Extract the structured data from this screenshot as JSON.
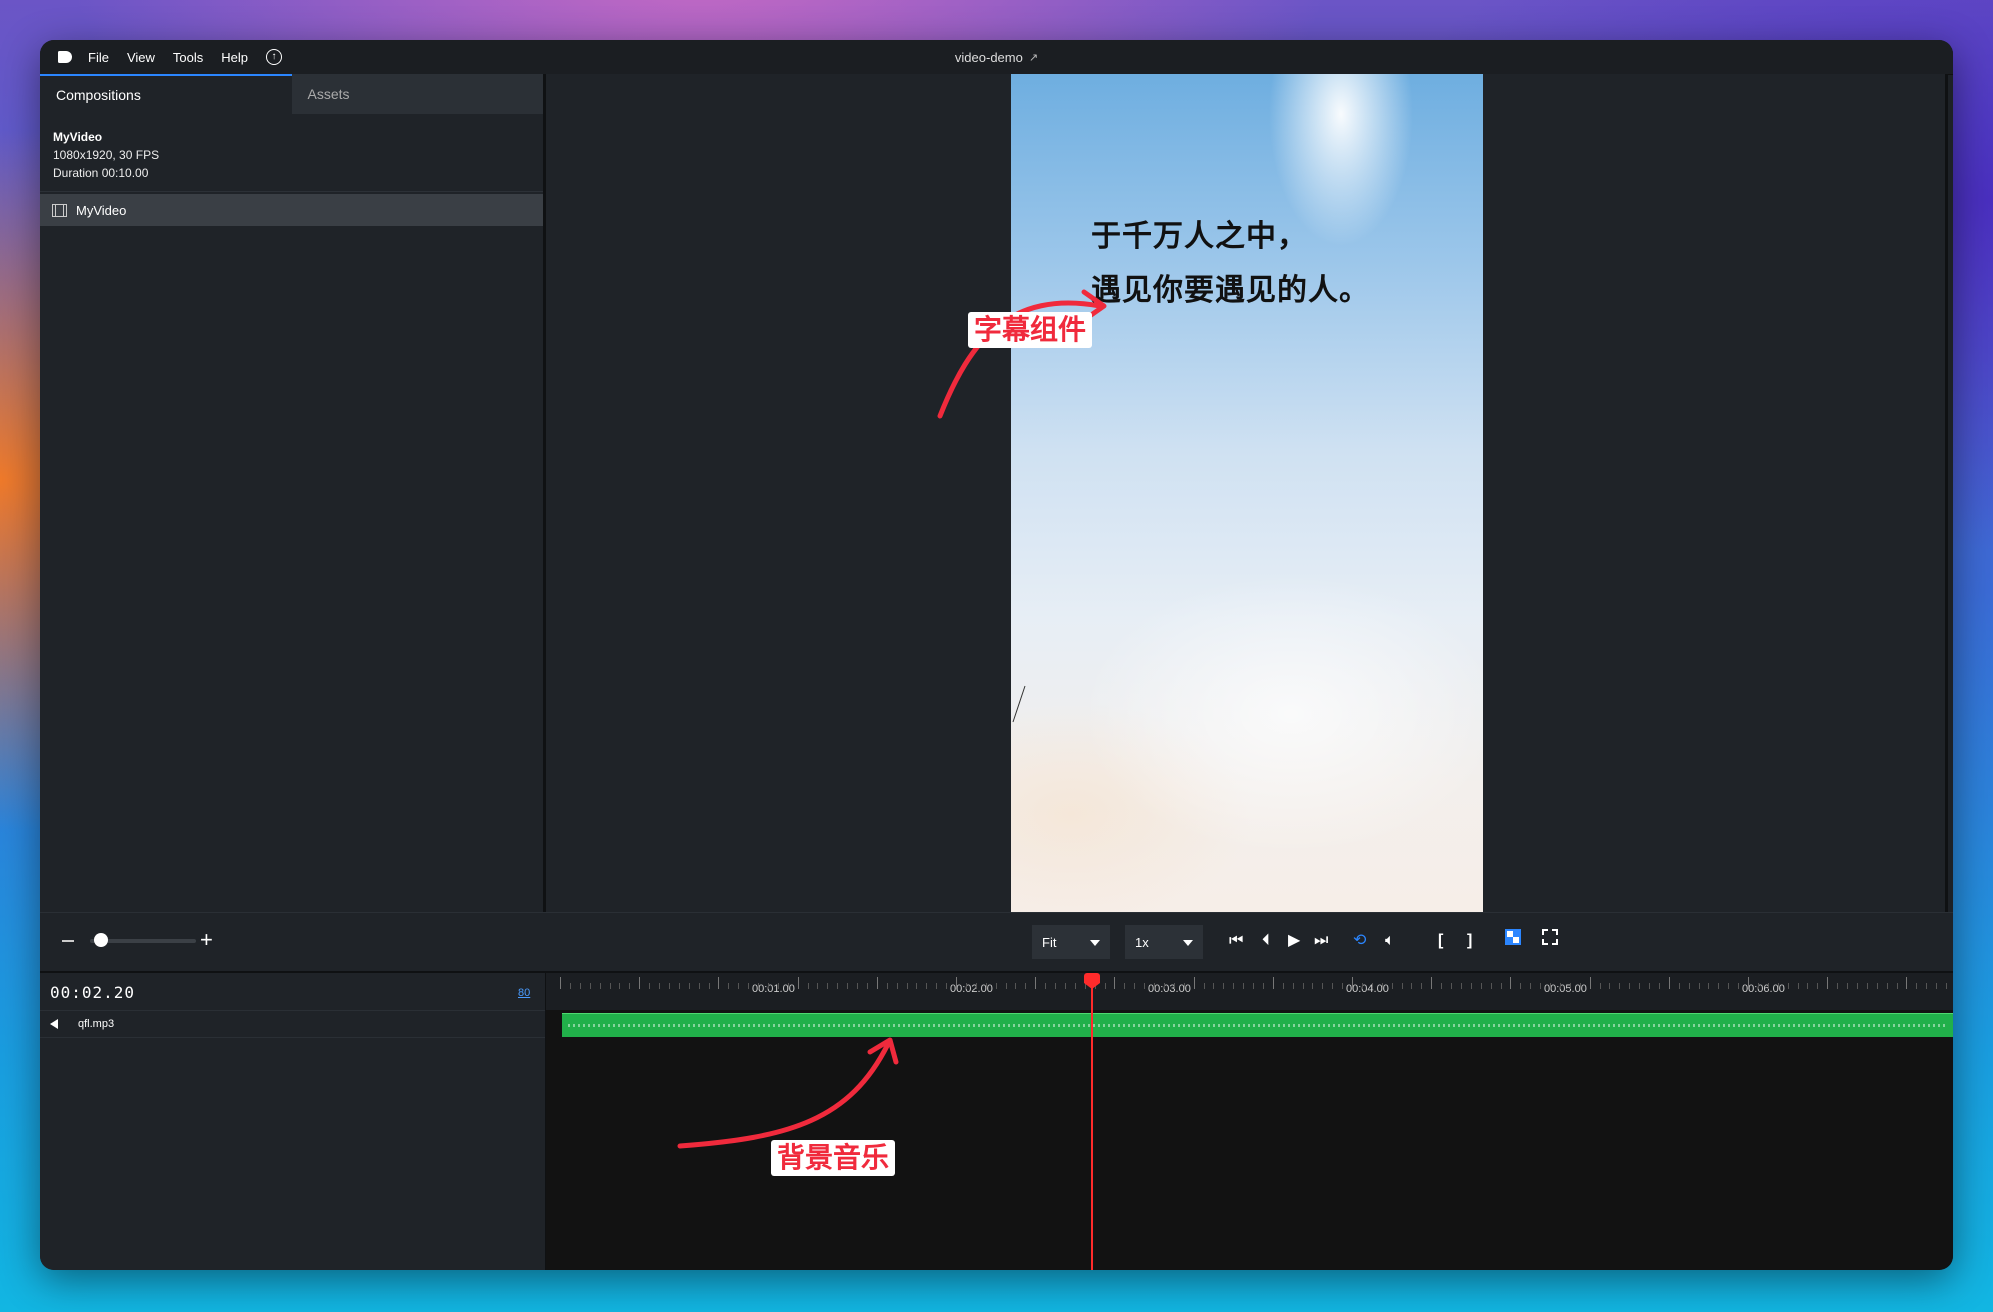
{
  "menu": {
    "items": [
      "File",
      "View",
      "Tools",
      "Help"
    ],
    "window_title": "video-demo"
  },
  "sidebar": {
    "tabs": [
      {
        "label": "Compositions",
        "active": true
      },
      {
        "label": "Assets",
        "active": false
      }
    ],
    "composition": {
      "name": "MyVideo",
      "resolution": "1080x1920, 30 FPS",
      "duration": "Duration 00:10.00"
    },
    "items": [
      {
        "label": "MyVideo",
        "selected": true
      }
    ]
  },
  "preview": {
    "caption_line1": "于千万人之中，",
    "caption_line2": "遇见你要遇见的人。"
  },
  "annotations": {
    "subtitle": "字幕组件",
    "music": "背景音乐",
    "color": "#f02a3c"
  },
  "toolbar": {
    "zoom_level": 0.1,
    "fit_select": "Fit",
    "speed_select": "1x"
  },
  "timeline": {
    "timecode": "00:02.20",
    "fps": "80",
    "track_name": "qfl.mp3",
    "ruler_labels": [
      "00:01.00",
      "00:02.00",
      "00:03.00",
      "00:04.00",
      "00:05.00",
      "00:06.00"
    ],
    "accent_color": "#21b04a",
    "playhead_color": "#ff2b2b"
  }
}
